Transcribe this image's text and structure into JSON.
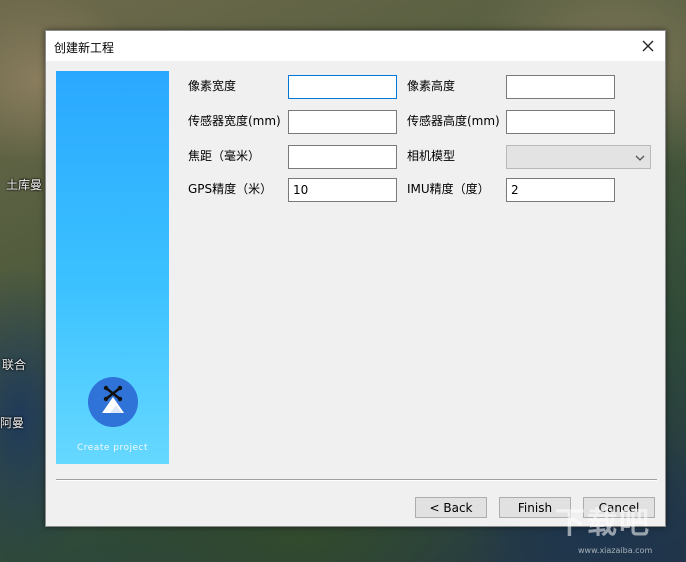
{
  "background": {
    "map_labels": [
      "土库曼",
      "联合",
      "阿曼"
    ]
  },
  "dialog": {
    "title": "创建新工程",
    "banner": {
      "caption": "Create project"
    },
    "fields": {
      "pixel_width": {
        "label": "像素宽度",
        "value": ""
      },
      "pixel_height": {
        "label": "像素高度",
        "value": ""
      },
      "sensor_width": {
        "label": "传感器宽度(mm)",
        "value": ""
      },
      "sensor_height": {
        "label": "传感器高度(mm)",
        "value": ""
      },
      "focal_length": {
        "label": "焦距（毫米）",
        "value": ""
      },
      "camera_model": {
        "label": "相机模型",
        "value": ""
      },
      "gps_accuracy": {
        "label": "GPS精度（米）",
        "value": "10"
      },
      "imu_accuracy": {
        "label": "IMU精度（度）",
        "value": "2"
      }
    },
    "buttons": {
      "back": "< Back",
      "finish": "Finish",
      "cancel": "Cancel"
    }
  },
  "watermark": {
    "text": "下载吧",
    "url": "www.xiazaiba.com"
  }
}
